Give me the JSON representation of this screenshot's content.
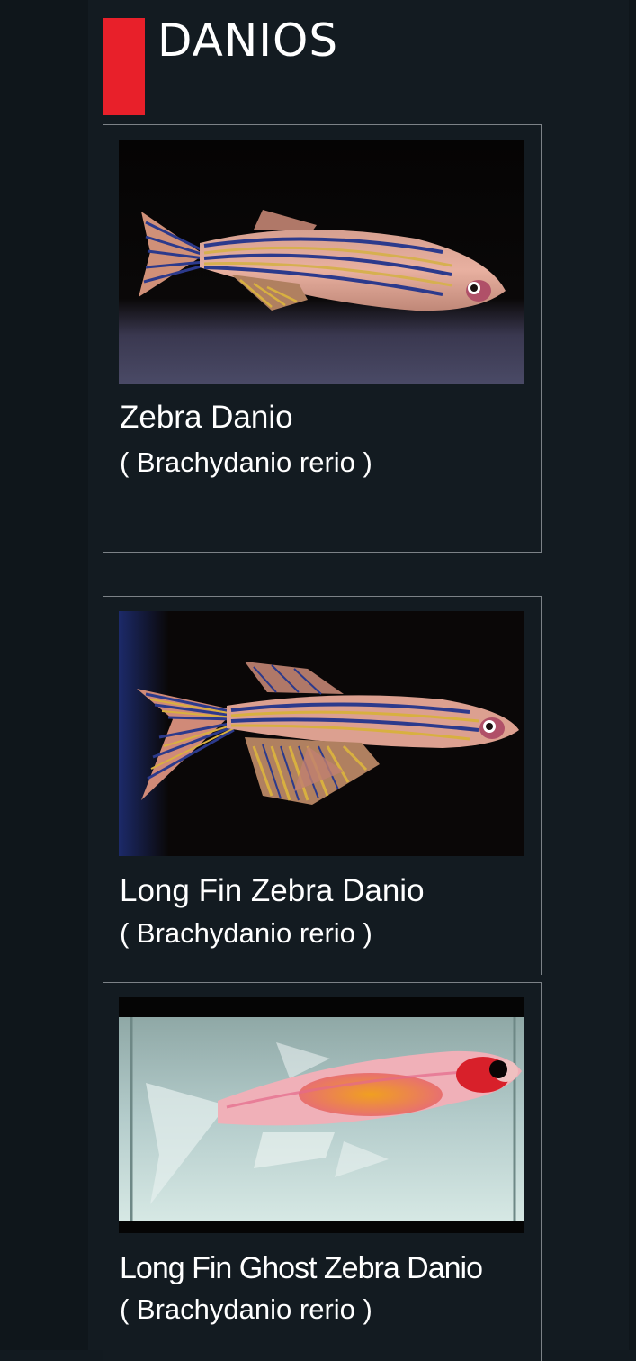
{
  "header": {
    "title": "DANIOS"
  },
  "fish": [
    {
      "common_name": "Zebra Danio",
      "scientific_name": "( Brachydanio rerio )"
    },
    {
      "common_name": "Long Fin Zebra Danio",
      "scientific_name": "( Brachydanio rerio )"
    },
    {
      "common_name": "Long Fin Ghost Zebra Danio",
      "scientific_name": "( Brachydanio rerio )"
    }
  ],
  "colors": {
    "accent": "#e8202a",
    "background": "#131b21",
    "border": "#7c8287",
    "text": "#ffffff"
  }
}
